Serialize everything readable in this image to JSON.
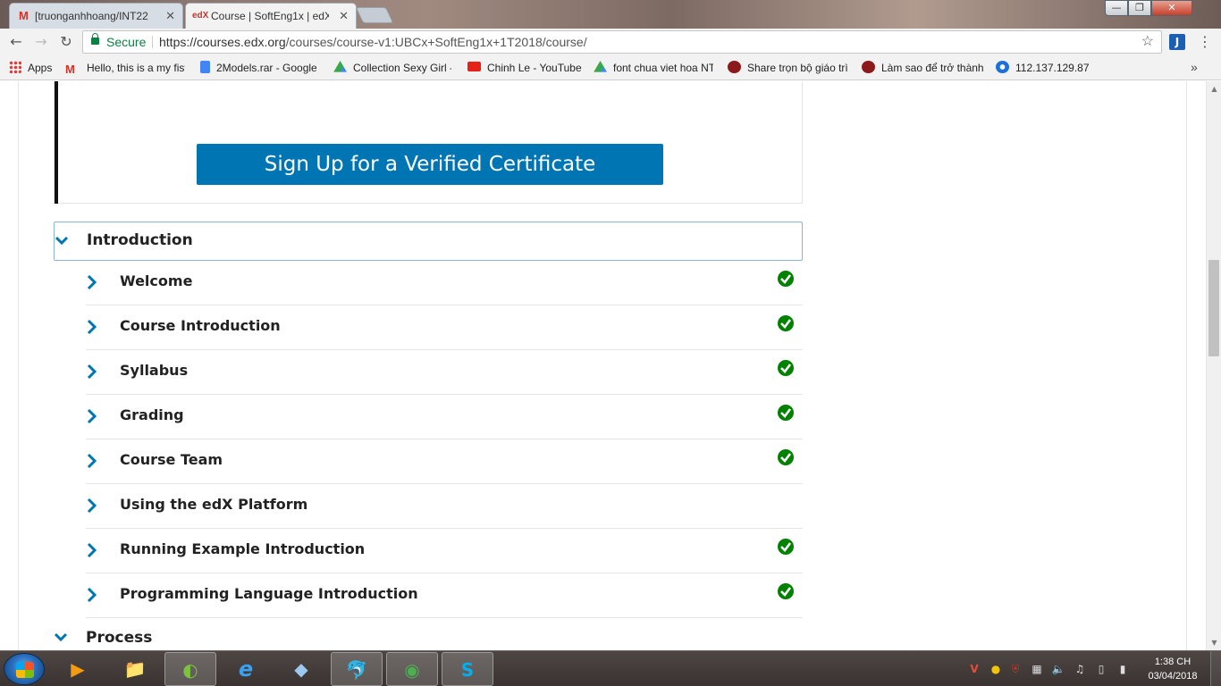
{
  "browser": {
    "tabs": [
      {
        "favicon": "gmail-icon",
        "title": "[truonganhhoang/INT22",
        "close": "✕"
      },
      {
        "favicon": "edx-icon",
        "favicon_text": "edX",
        "title": "Course | SoftEng1x | edX",
        "close": "✕"
      }
    ],
    "window_controls": {
      "minimize": "—",
      "maximize": "❐",
      "close": "✕"
    },
    "security_label": "Secure",
    "url_host": "https://courses.edx.org",
    "url_path": "/courses/course-v1:UBCx+SoftEng1x+1T2018/course/",
    "extension_label": "J",
    "bookmarks": [
      {
        "label": "Apps",
        "icon": "apps-grid-icon"
      },
      {
        "label": "Hello, this is a my fist",
        "icon": "gmail-icon"
      },
      {
        "label": "2Models.rar - Google",
        "icon": "file-icon"
      },
      {
        "label": "Collection Sexy Girl -",
        "icon": "drive-icon"
      },
      {
        "label": "Chinh Le - YouTube",
        "icon": "youtube-icon"
      },
      {
        "label": "font chua viet hoa NT",
        "icon": "drive-icon"
      },
      {
        "label": "Share trọn bộ giáo trì",
        "icon": "site-icon"
      },
      {
        "label": "Làm sao để trở thành",
        "icon": "site-icon"
      },
      {
        "label": "112.137.129.87",
        "icon": "globe-icon"
      }
    ],
    "bookmarks_overflow": "»"
  },
  "course": {
    "verify_button": "Sign Up for a Verified Certificate",
    "sections": [
      {
        "title": "Introduction",
        "expanded": true,
        "subsections": [
          {
            "title": "Welcome",
            "completed": true
          },
          {
            "title": "Course Introduction",
            "completed": true
          },
          {
            "title": "Syllabus",
            "completed": true
          },
          {
            "title": "Grading",
            "completed": true
          },
          {
            "title": "Course Team",
            "completed": true
          },
          {
            "title": "Using the edX Platform",
            "completed": false
          },
          {
            "title": "Running Example Introduction",
            "completed": true
          },
          {
            "title": "Programming Language Introduction",
            "completed": true
          }
        ]
      },
      {
        "title": "Process",
        "expanded": true
      }
    ]
  },
  "taskbar": {
    "apps": [
      {
        "name": "media-player-icon",
        "glyph": "▶"
      },
      {
        "name": "file-explorer-icon",
        "glyph": "📁"
      },
      {
        "name": "coccoc-browser-icon",
        "glyph": "◐"
      },
      {
        "name": "internet-explorer-icon",
        "glyph": "e"
      },
      {
        "name": "virtualbox-icon",
        "glyph": "◆"
      },
      {
        "name": "mysql-workbench-icon",
        "glyph": "🐬"
      },
      {
        "name": "chrome-icon",
        "glyph": "◉"
      },
      {
        "name": "skype-icon",
        "glyph": "S"
      }
    ],
    "clock_time": "1:38 CH",
    "clock_date": "03/04/2018"
  },
  "colors": {
    "edx_blue": "#0075b4",
    "chevron_blue": "#0075b4",
    "check_green": "#008100"
  }
}
